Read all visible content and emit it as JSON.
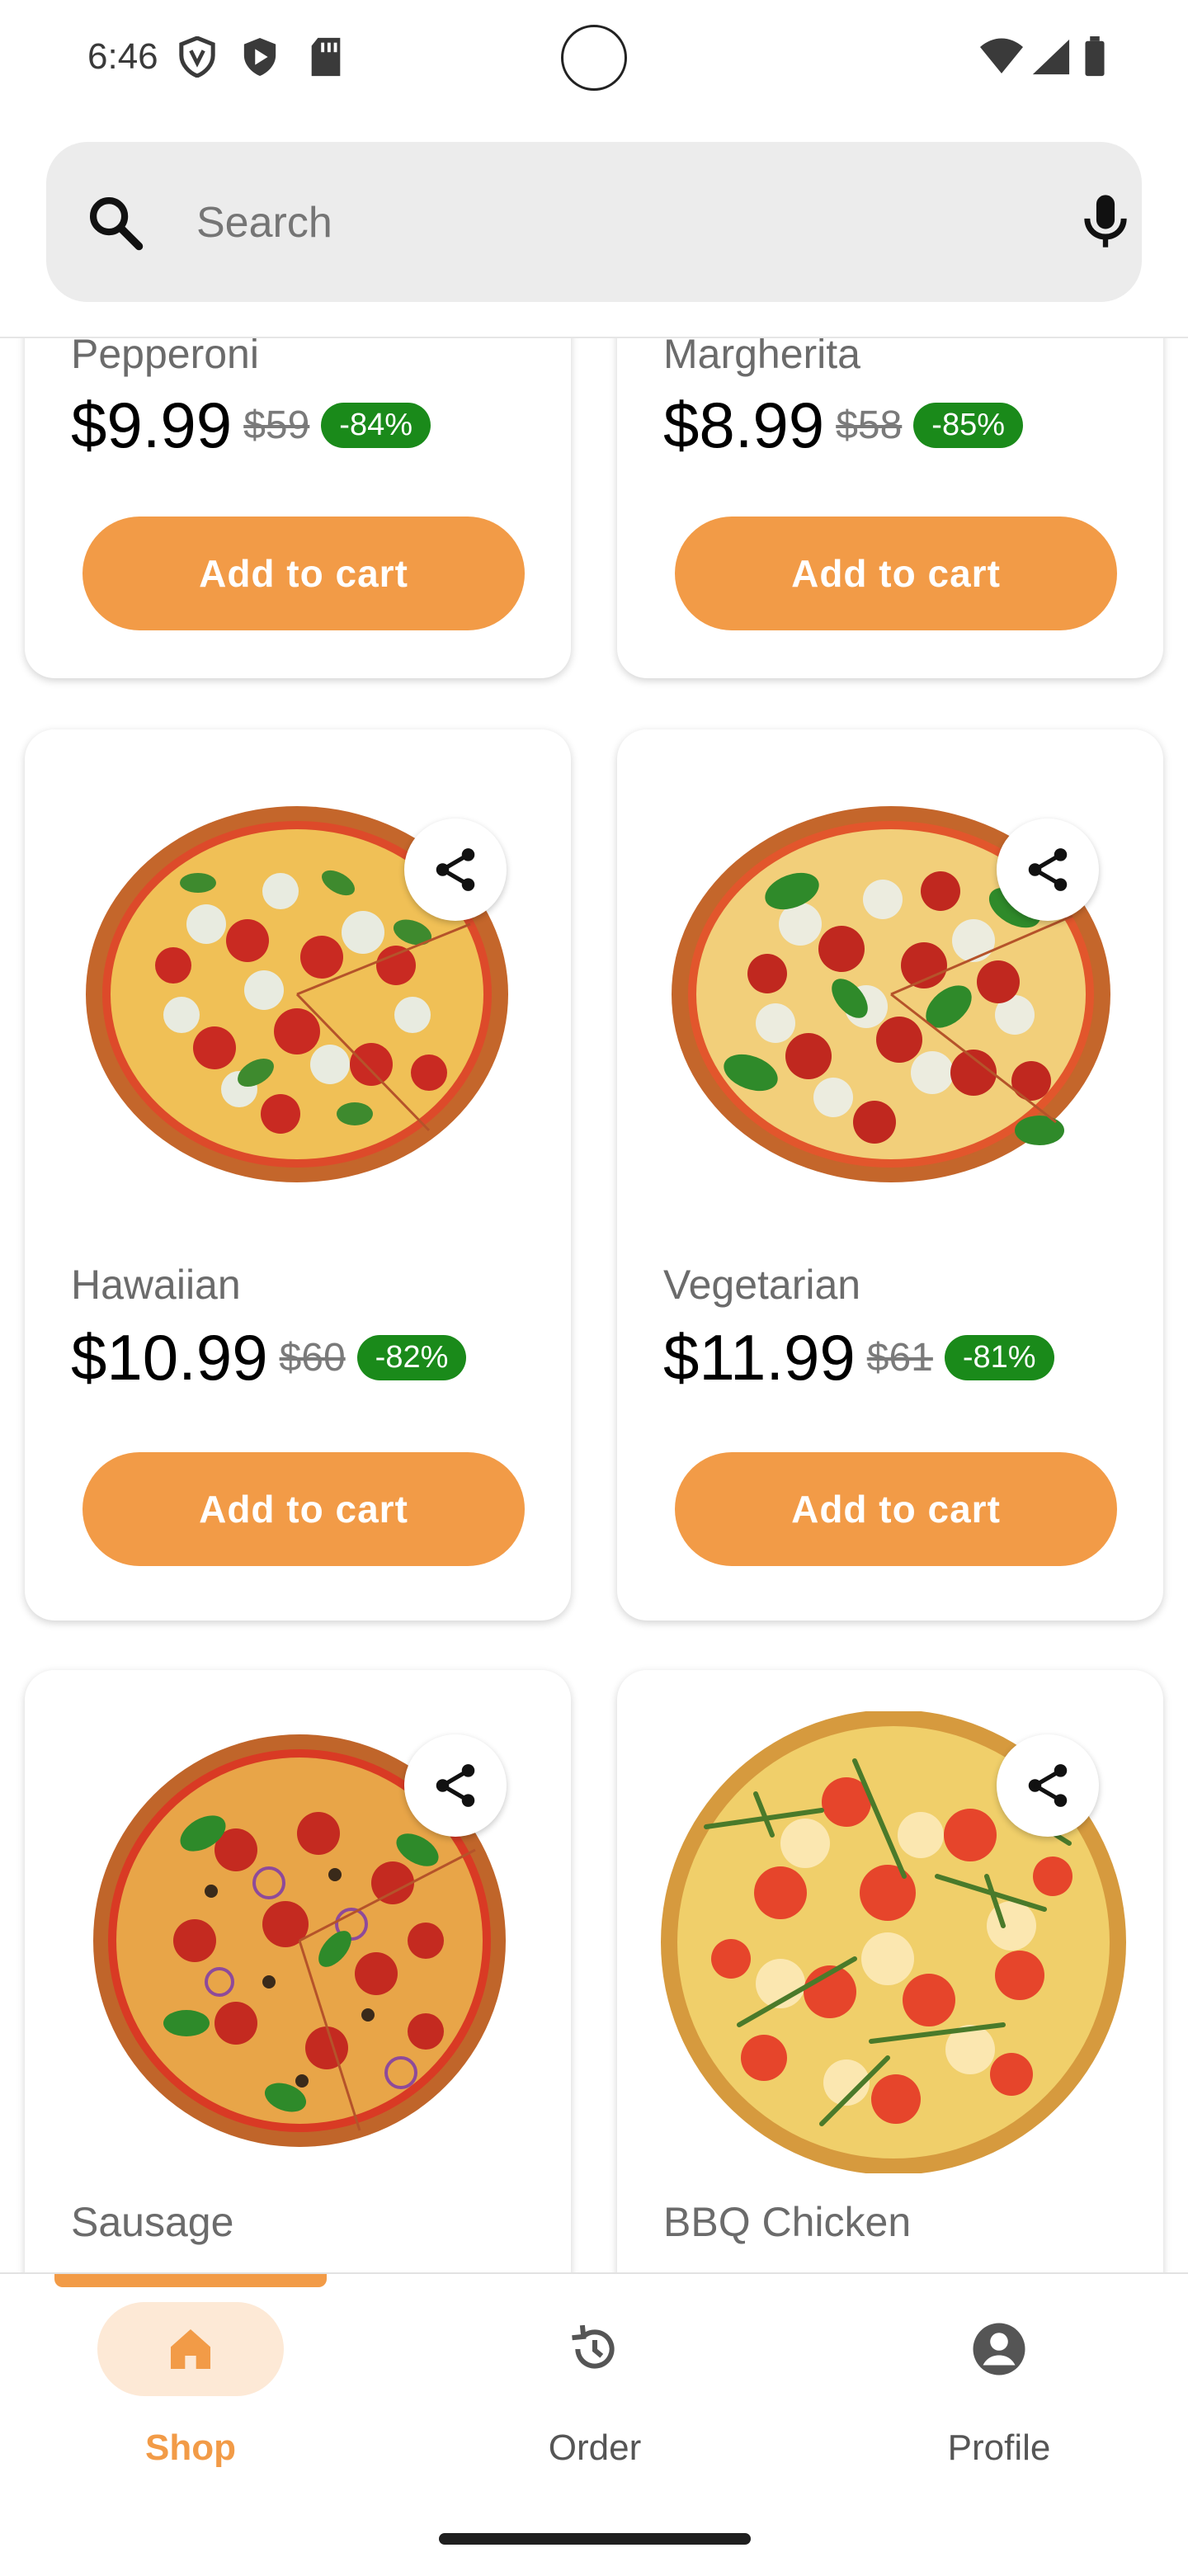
{
  "status_bar": {
    "time": "6:46"
  },
  "search": {
    "placeholder": "Search"
  },
  "products": [
    {
      "name": "Pepperoni",
      "price": "$9.99",
      "original_price": "$59",
      "discount": "-84%",
      "button": "Add to cart"
    },
    {
      "name": "Margherita",
      "price": "$8.99",
      "original_price": "$58",
      "discount": "-85%",
      "button": "Add to cart"
    },
    {
      "name": "Hawaiian",
      "price": "$10.99",
      "original_price": "$60",
      "discount": "-82%",
      "button": "Add to cart"
    },
    {
      "name": "Vegetarian",
      "price": "$11.99",
      "original_price": "$61",
      "discount": "-81%",
      "button": "Add to cart"
    },
    {
      "name": "Sausage"
    },
    {
      "name": "BBQ Chicken"
    }
  ],
  "nav": {
    "items": [
      {
        "label": "Shop",
        "icon": "home-icon",
        "active": true
      },
      {
        "label": "Order",
        "icon": "history-icon",
        "active": false
      },
      {
        "label": "Profile",
        "icon": "account-circle-icon",
        "active": false
      }
    ]
  },
  "colors": {
    "accent": "#f29b47",
    "accent_light": "#fde9d6",
    "discount_badge": "#1a8a1a",
    "search_bg": "#ececec"
  }
}
